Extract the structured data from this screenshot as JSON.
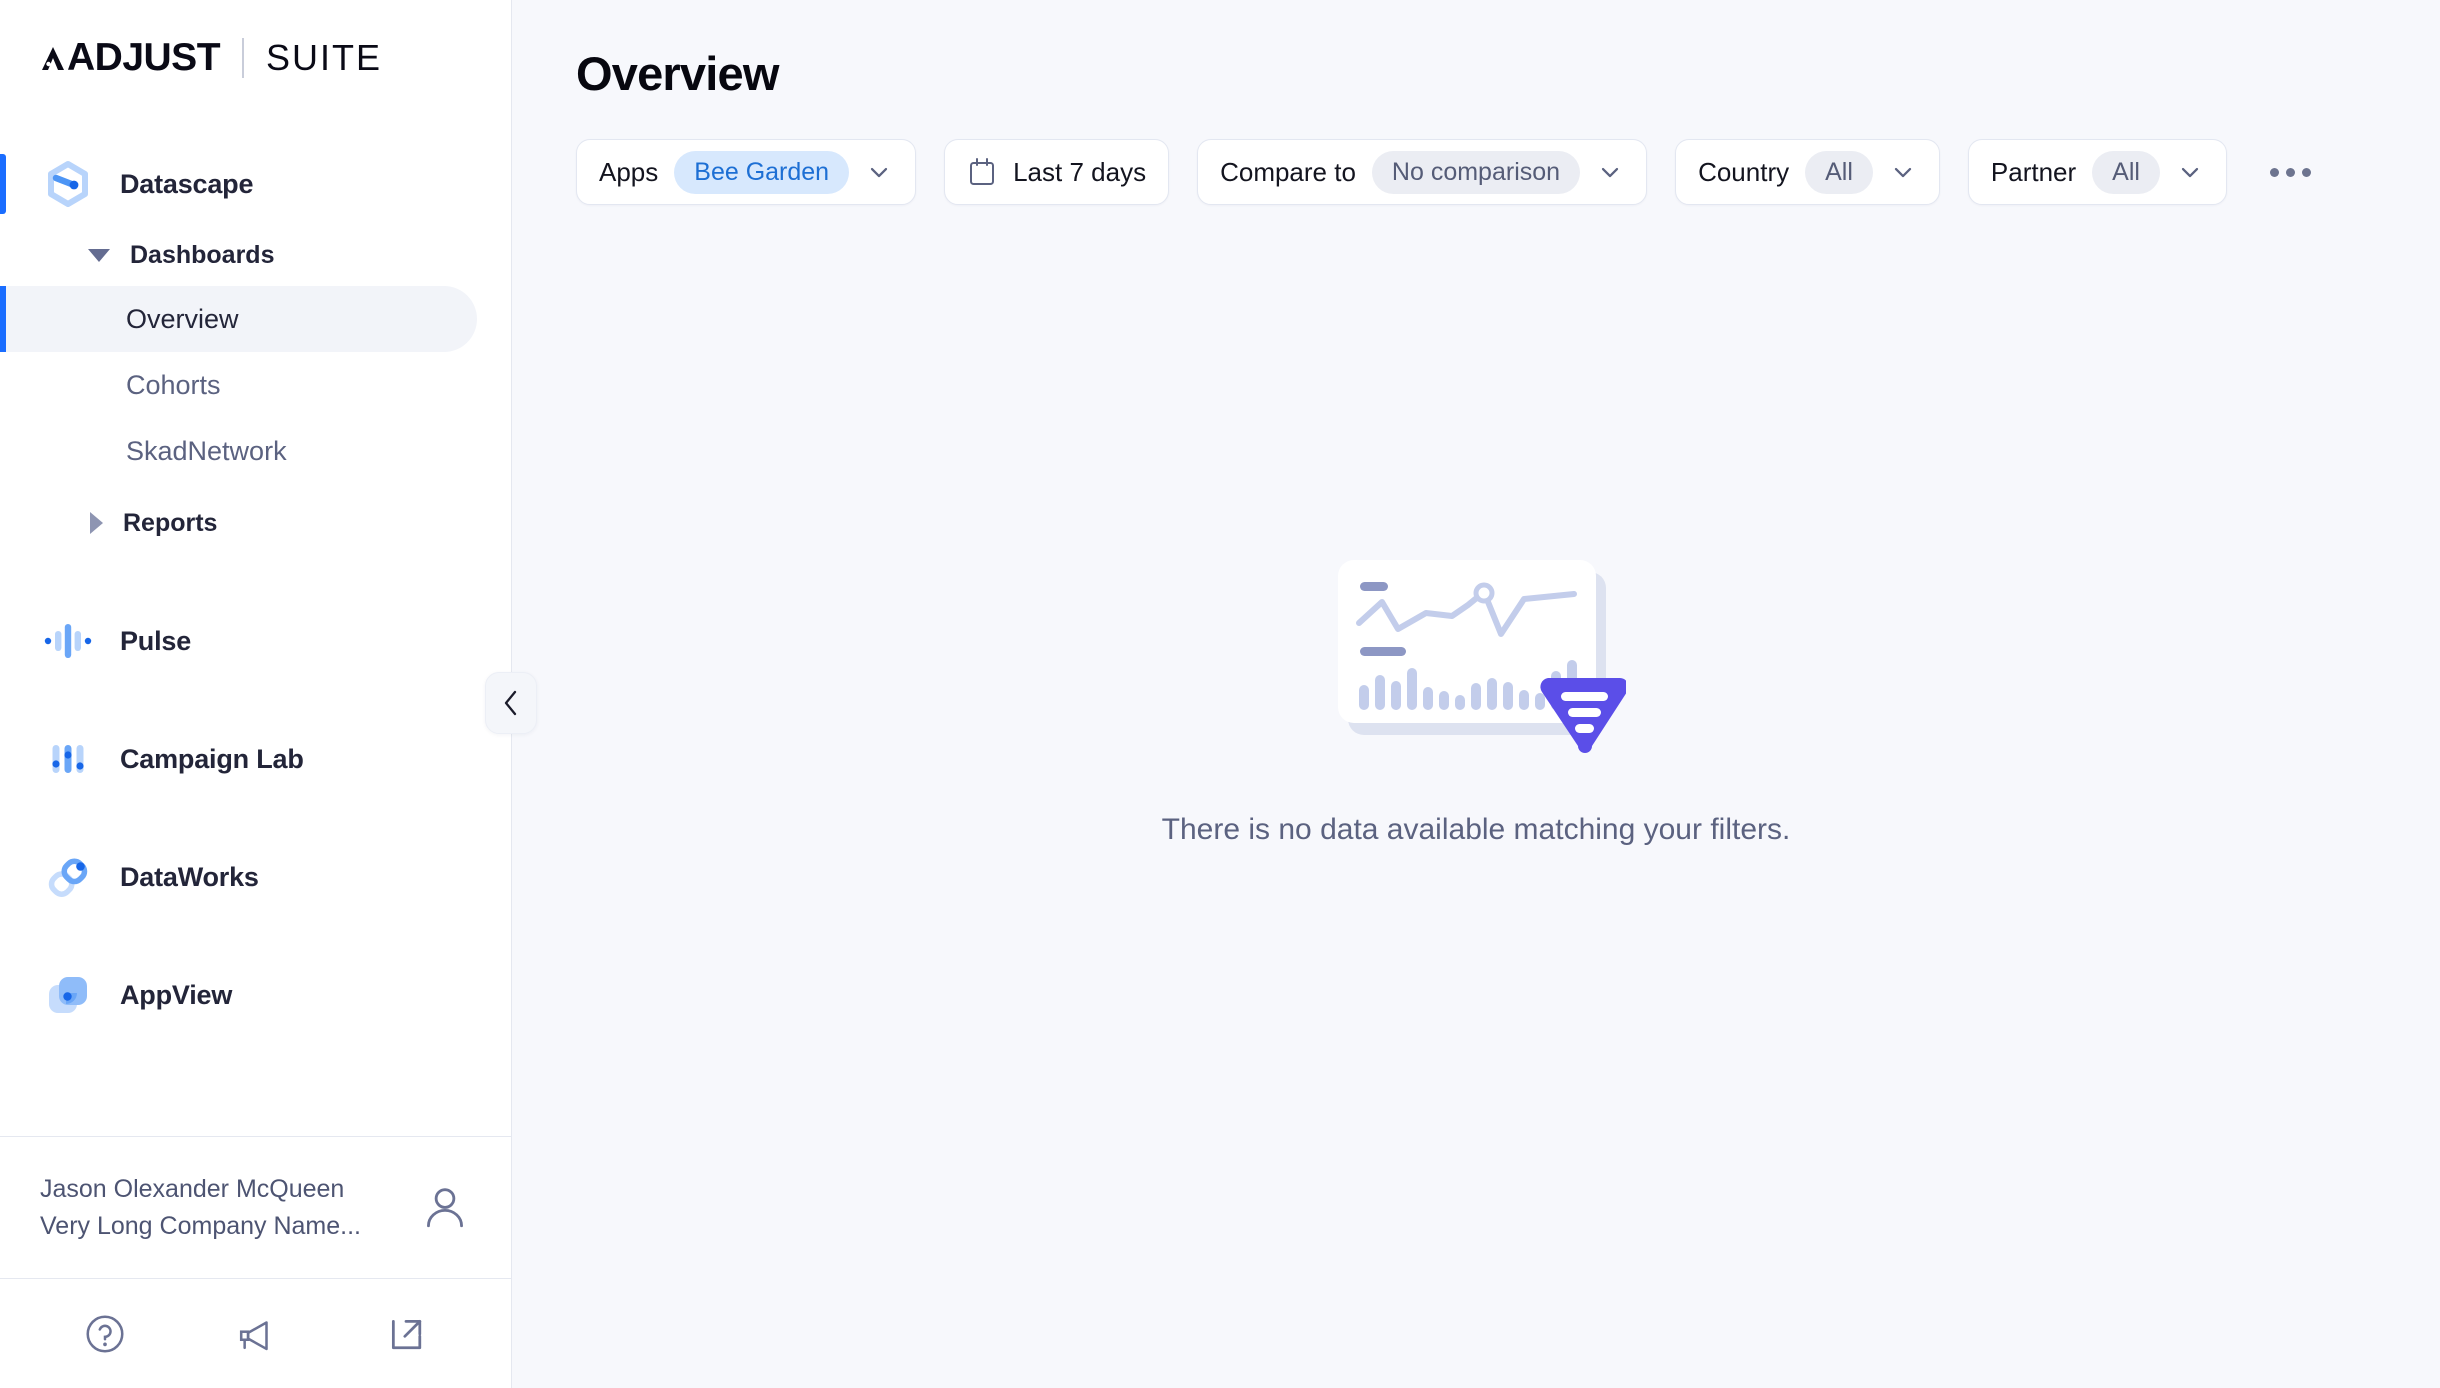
{
  "brand": {
    "primary": "ADJUST",
    "secondary": "SUITE"
  },
  "sidebar": {
    "product_sections": [
      {
        "label": "Datascape",
        "icon": "datascape-hexagon-icon",
        "active": true,
        "groups": [
          {
            "label": "Dashboards",
            "expanded": true,
            "icon": "triangle-down-icon",
            "items": [
              {
                "label": "Overview",
                "active": true
              },
              {
                "label": "Cohorts",
                "active": false
              },
              {
                "label": "SkadNetwork",
                "active": false
              }
            ]
          },
          {
            "label": "Reports",
            "expanded": false,
            "icon": "triangle-right-icon",
            "items": []
          }
        ]
      },
      {
        "label": "Pulse",
        "icon": "pulse-waveform-icon",
        "active": false,
        "groups": []
      },
      {
        "label": "Campaign Lab",
        "icon": "campaign-lab-sliders-icon",
        "active": false,
        "groups": []
      },
      {
        "label": "DataWorks",
        "icon": "dataworks-link-icon",
        "active": false,
        "groups": []
      },
      {
        "label": "AppView",
        "icon": "appview-squares-icon",
        "active": false,
        "groups": []
      }
    ],
    "user": {
      "name": "Jason Olexander McQueen",
      "company": "Very Long Company Name...",
      "avatar_icon": "person-icon"
    },
    "footer_icons": [
      {
        "name": "help-circle-icon"
      },
      {
        "name": "megaphone-icon"
      },
      {
        "name": "external-link-icon"
      }
    ],
    "collapse_icon": "chevron-left-icon"
  },
  "main": {
    "page_title": "Overview",
    "filters": [
      {
        "label": "Apps",
        "value": "Bee Garden",
        "value_style": "blue",
        "leading_icon": null,
        "chevron": true
      },
      {
        "label": "Last 7 days",
        "value": null,
        "value_style": null,
        "leading_icon": "calendar-icon",
        "chevron": false
      },
      {
        "label": "Compare to",
        "value": "No comparison",
        "value_style": "grey",
        "leading_icon": null,
        "chevron": true
      },
      {
        "label": "Country",
        "value": "All",
        "value_style": "grey",
        "leading_icon": null,
        "chevron": true
      },
      {
        "label": "Partner",
        "value": "All",
        "value_style": "grey",
        "leading_icon": null,
        "chevron": true
      }
    ],
    "more_menu_icon": "ellipsis-horizontal-icon",
    "empty_state": {
      "illustration_icon": "no-data-chart-with-funnel-illustration",
      "message": "There is no data available matching your filters."
    }
  },
  "colors": {
    "accent_blue": "#1a6dff",
    "pill_blue_bg": "#d7e8fd",
    "pill_blue_text": "#1d6fd4",
    "pill_grey_bg": "#ebedf3",
    "funnel_purple": "#5b4ee8",
    "canvas_bg": "#f7f8fc",
    "text_dark": "#232539",
    "text_muted": "#5b6280"
  }
}
